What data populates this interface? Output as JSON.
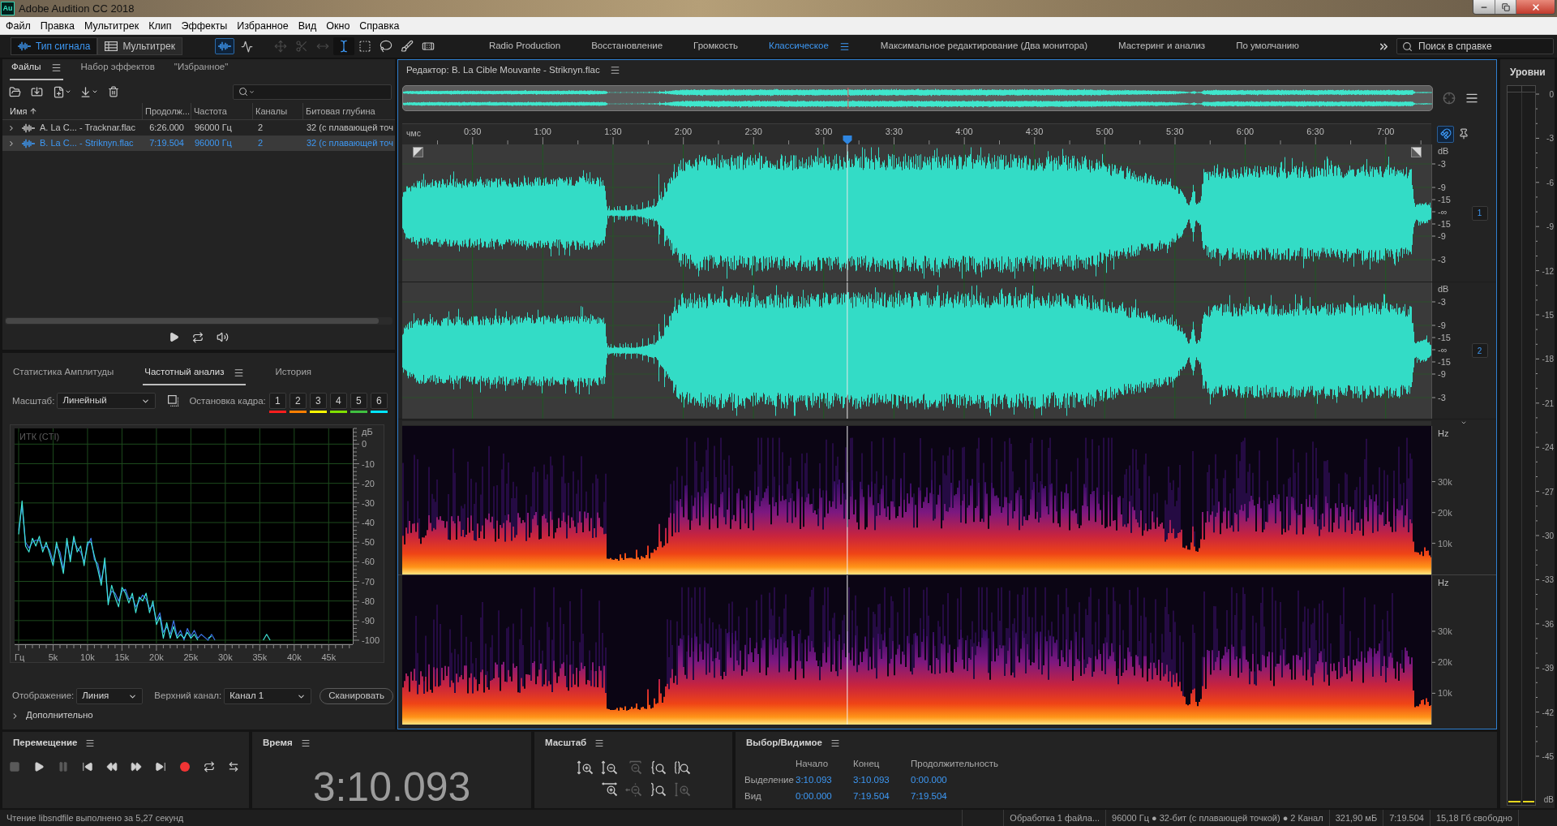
{
  "window": {
    "title": "Adobe Audition CC 2018",
    "app_badge": "Au"
  },
  "menu": [
    "Файл",
    "Правка",
    "Мультитрек",
    "Клип",
    "Эффекты",
    "Избранное",
    "Вид",
    "Окно",
    "Справка"
  ],
  "toolbar": {
    "modes": [
      {
        "label": "Тип сигнала",
        "kind": "waveform",
        "selected": true
      },
      {
        "label": "Мультитрек",
        "kind": "multitrack",
        "selected": false
      }
    ],
    "views": [
      {
        "kind": "waveform",
        "selected": true
      },
      {
        "kind": "spectral",
        "selected": false
      }
    ],
    "tools": [
      {
        "kind": "move",
        "selected": false,
        "disabled": true
      },
      {
        "kind": "razor",
        "selected": false,
        "disabled": true
      },
      {
        "kind": "slip",
        "selected": false,
        "disabled": true
      },
      {
        "kind": "time-selection",
        "selected": true,
        "disabled": false
      },
      {
        "kind": "marquee",
        "selected": false,
        "disabled": false
      },
      {
        "kind": "lasso",
        "selected": false,
        "disabled": false
      },
      {
        "kind": "brush",
        "selected": false,
        "disabled": false
      },
      {
        "kind": "healing",
        "selected": false,
        "disabled": false
      }
    ],
    "workspaces": [
      {
        "label": "Radio Production",
        "selected": false
      },
      {
        "label": "Восстановление",
        "selected": false
      },
      {
        "label": "Громкость",
        "selected": false
      },
      {
        "label": "Классическое",
        "selected": true
      },
      {
        "label": "Максимальное редактирование (Два монитора)",
        "selected": false
      },
      {
        "label": "Мастеринг и анализ",
        "selected": false
      },
      {
        "label": "По умолчанию",
        "selected": false
      }
    ],
    "help_search": {
      "placeholder": "Поиск в справке"
    }
  },
  "files_panel": {
    "tabs": [
      {
        "label": "Файлы",
        "selected": true
      },
      {
        "label": "Набор эффектов",
        "selected": false
      },
      {
        "label": "\"Избранное\"",
        "selected": false
      }
    ],
    "columns": [
      {
        "label": "Имя",
        "sorted": true
      },
      {
        "label": "Продолж...",
        "sorted": false
      },
      {
        "label": "Частота",
        "sorted": false
      },
      {
        "label": "Каналы",
        "sorted": false
      },
      {
        "label": "Битовая глубина",
        "sorted": false
      }
    ],
    "rows": [
      {
        "name": "A. La C... - Tracknar.flac",
        "duration": "6:26.000",
        "sample_rate": "96000 Гц",
        "channels": "2",
        "bit_depth": "32 (с плавающей точ",
        "selected": false,
        "expanded": false
      },
      {
        "name": "B. La C... - Striknyn.flac",
        "duration": "7:19.504",
        "sample_rate": "96000 Гц",
        "channels": "2",
        "bit_depth": "32 (с плавающей точ",
        "selected": true,
        "expanded": false
      }
    ]
  },
  "analysis_panel": {
    "tabs": [
      {
        "label": "Статистика Амплитуды",
        "selected": false
      },
      {
        "label": "Частотный анализ",
        "selected": true
      },
      {
        "label": "История",
        "selected": false
      }
    ],
    "scale": {
      "label": "Масштаб:",
      "value": "Линейный"
    },
    "freeze": {
      "label": "Остановка кадра:",
      "slots": [
        {
          "label": "1",
          "color": "#ff1e1e"
        },
        {
          "label": "2",
          "color": "#ff7f00"
        },
        {
          "label": "3",
          "color": "#ffff00"
        },
        {
          "label": "4",
          "color": "#80e000"
        },
        {
          "label": "5",
          "color": "#40c040"
        },
        {
          "label": "6",
          "color": "#00e5ff"
        }
      ]
    },
    "chart": {
      "label": "ИТК (CTI)",
      "chart_data": {
        "type": "line",
        "ylabel": "дБ",
        "grid": true,
        "x": [
          0,
          500,
          1000,
          1500,
          2000,
          2500,
          3000,
          3500,
          4000,
          4500,
          5000,
          5500,
          6000,
          6500,
          7000,
          7500,
          8000,
          8500,
          9000,
          9500,
          10000,
          10500,
          11000,
          11500,
          12000,
          12500,
          13000,
          13500,
          14000,
          14500,
          15000,
          15500,
          16000,
          16500,
          17000,
          17500,
          18000,
          18500,
          19000,
          19500,
          20000,
          20500,
          21000,
          21500,
          22000,
          22500,
          23000,
          23500,
          24000,
          24500,
          25000,
          25500,
          26000,
          26500,
          27500,
          28000,
          28500,
          35500,
          36000,
          36500
        ],
        "series": [
          {
            "color": "#3fe3d6",
            "values": [
              -46,
              -29,
              -52,
              -55,
              -48,
              -52,
              -47,
              -55,
              -50,
              -56,
              -62,
              -50,
              -58,
              -66,
              -48,
              -60,
              -47,
              -55,
              -52,
              -62,
              -50,
              -50,
              -57,
              -64,
              -72,
              -58,
              -82,
              -72,
              -78,
              -83,
              -73,
              -76,
              -81,
              -76,
              -86,
              -78,
              -80,
              -76,
              -86,
              -80,
              -92,
              -88,
              -99,
              -91,
              -99,
              -93,
              -99,
              -97,
              -99,
              -96,
              -99,
              -97,
              -100,
              null,
              -99,
              -98,
              null,
              -100,
              -97,
              -100
            ]
          },
          {
            "color": "#3b72e4",
            "values": [
              -44,
              -31,
              -50,
              -53,
              -50,
              -49,
              -49,
              -53,
              -52,
              -54,
              -60,
              -52,
              -55,
              -64,
              -50,
              -58,
              -49,
              -53,
              -55,
              -60,
              -52,
              -48,
              -59,
              -61,
              -70,
              -60,
              -80,
              -75,
              -76,
              -80,
              -75,
              -74,
              -79,
              -78,
              -83,
              -80,
              -77,
              -79,
              -84,
              -82,
              -90,
              -86,
              -96,
              -93,
              -97,
              -90,
              -98,
              -95,
              -100,
              -94,
              -98,
              -95,
              -99,
              -97,
              -100,
              -97,
              -100,
              null,
              null,
              null
            ]
          }
        ],
        "xlim": [
          0,
          48500
        ],
        "ylim": [
          -100,
          8
        ],
        "xticks": [
          {
            "value": 0,
            "label": "Гц"
          },
          {
            "value": 5000,
            "label": "5k"
          },
          {
            "value": 10000,
            "label": "10k"
          },
          {
            "value": 15000,
            "label": "15k"
          },
          {
            "value": 20000,
            "label": "20k"
          },
          {
            "value": 25000,
            "label": "25k"
          },
          {
            "value": 30000,
            "label": "30k"
          },
          {
            "value": 35000,
            "label": "35k"
          },
          {
            "value": 40000,
            "label": "40k"
          },
          {
            "value": 45000,
            "label": "45k"
          }
        ],
        "yticks": [
          0,
          -10,
          -20,
          -30,
          -40,
          -50,
          -60,
          -70,
          -80,
          -90,
          -100
        ]
      }
    },
    "display": {
      "label": "Отображение:",
      "value": "Линия"
    },
    "top_channel": {
      "label": "Верхний канал:",
      "value": "Канал 1"
    },
    "scan_button": "Сканировать",
    "advanced": {
      "label": "Дополнительно",
      "expanded": false
    }
  },
  "editor": {
    "title": "Редактор: B. La Cible Mouvante - Striknyn.flac",
    "playhead": {
      "level": 0.4325
    },
    "ruler": {
      "unit": "чмс",
      "ticks": [
        "0:30",
        "1:00",
        "1:30",
        "2:00",
        "2:30",
        "3:00",
        "3:30",
        "4:00",
        "4:30",
        "5:00",
        "5:30",
        "6:00",
        "6:30",
        "7:00"
      ],
      "snap": true
    },
    "waveform_channels": [
      {
        "badge": "1",
        "scale": [
          "dB",
          "-3",
          "-9",
          "-15",
          "-∞",
          "-15",
          "-9",
          "-3"
        ]
      },
      {
        "badge": "2",
        "scale": [
          "dB",
          "-3",
          "-9",
          "-15",
          "-∞",
          "-15",
          "-9",
          "-3"
        ]
      }
    ],
    "spectral_channels": [
      {
        "scale": [
          "Hz",
          "30k",
          "20k",
          "10k"
        ]
      },
      {
        "scale": [
          "Hz",
          "30k",
          "20k",
          "10k"
        ]
      }
    ]
  },
  "levels": {
    "title": "Уровни",
    "scale": [
      "0",
      "-3",
      "-6",
      "-9",
      "-12",
      "-15",
      "-18",
      "-21",
      "-24",
      "-27",
      "-30",
      "-33",
      "-36",
      "-39",
      "-42",
      "-45",
      "dB"
    ]
  },
  "transport": {
    "title": "Перемещение",
    "buttons": [
      {
        "kind": "stop",
        "disabled": true
      },
      {
        "kind": "play",
        "disabled": false
      },
      {
        "kind": "pause",
        "disabled": true
      },
      {
        "kind": "to-start",
        "disabled": false
      },
      {
        "kind": "rewind",
        "disabled": false
      },
      {
        "kind": "fast-forward",
        "disabled": false
      },
      {
        "kind": "to-end",
        "disabled": false
      },
      {
        "kind": "record",
        "disabled": false
      },
      {
        "kind": "loop",
        "disabled": false
      },
      {
        "kind": "skip",
        "disabled": false
      }
    ]
  },
  "time": {
    "title": "Время",
    "value": "3:10.093"
  },
  "zoom": {
    "title": "Масштаб",
    "rows": [
      {
        "buttons": [
          {
            "kind": "in-amplitude",
            "disabled": false
          },
          {
            "kind": "out-amplitude",
            "disabled": false
          },
          {
            "kind": "out-full",
            "disabled": true
          },
          {
            "kind": "in-point",
            "disabled": false
          },
          {
            "kind": "selection",
            "disabled": false
          }
        ]
      },
      {
        "buttons": [
          {
            "kind": "in-time",
            "disabled": false
          },
          {
            "kind": "out-time",
            "disabled": true
          },
          {
            "kind": "out-point",
            "disabled": false
          },
          {
            "kind": "reset-amplitude",
            "disabled": true
          }
        ]
      }
    ]
  },
  "selection": {
    "title": "Выбор/Видимое",
    "columns": [
      "Начало",
      "Конец",
      "Продолжительность"
    ],
    "rows": [
      {
        "label": "Выделение",
        "values": [
          "3:10.093",
          "3:10.093",
          "0:00.000"
        ]
      },
      {
        "label": "Вид",
        "values": [
          "0:00.000",
          "7:19.504",
          "7:19.504"
        ]
      }
    ]
  },
  "status_bar": {
    "message": "Чтение libsndfile выполнено за 5,27 секунд",
    "items": [
      "Обработка 1 файла...",
      "96000 Гц ● 32-бит (с плавающей точкой) ● 2 Канал",
      "321,90 мБ",
      "7:19.504",
      "15,18 Гб свободно"
    ]
  }
}
